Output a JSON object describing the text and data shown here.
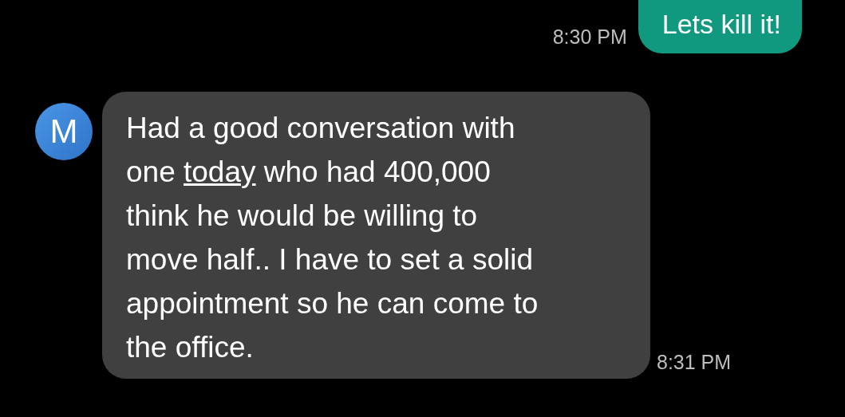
{
  "messages": [
    {
      "kind": "sent",
      "time": "8:30 PM",
      "lines": [
        [
          {
            "kind": "text",
            "text": "Lets kill it!"
          }
        ]
      ]
    },
    {
      "kind": "received",
      "avatar": "M",
      "time": "8:31 PM",
      "lines": [
        [
          {
            "kind": "text",
            "text": "Had a good conversation with"
          }
        ],
        [
          {
            "kind": "text",
            "text": "one "
          },
          {
            "kind": "link",
            "text": "today"
          },
          {
            "kind": "text",
            "text": " who had 400,000"
          }
        ],
        [
          {
            "kind": "text",
            "text": "think he would be willing to"
          }
        ],
        [
          {
            "kind": "text",
            "text": "move half.. I have to set a solid"
          }
        ],
        [
          {
            "kind": "text",
            "text": "appointment so he can come to"
          }
        ],
        [
          {
            "kind": "text",
            "text": "the office."
          }
        ]
      ]
    }
  ]
}
